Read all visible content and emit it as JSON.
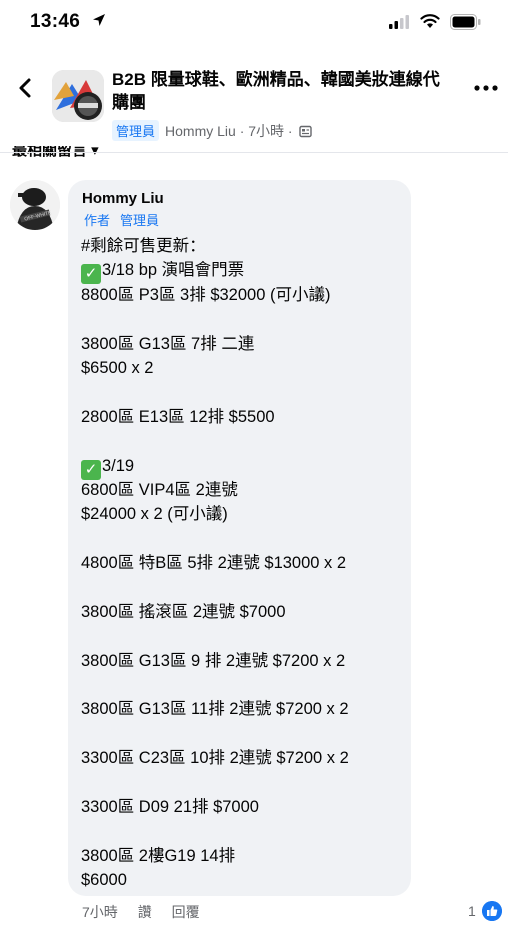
{
  "status_bar": {
    "time": "13:46"
  },
  "header": {
    "group_name": "B2B 限量球鞋、歐洲精品、韓國美妝連線代購團",
    "admin_badge": "管理員",
    "author_meta": "Hommy Liu · 7小時 ·"
  },
  "sort": {
    "label": "最相關留言"
  },
  "comment": {
    "author": "Hommy Liu",
    "badges": [
      "作者",
      "管理員"
    ],
    "lines": [
      {
        "check": false,
        "text": "#剩餘可售更新："
      },
      {
        "check": true,
        "text": "3/18 bp 演唱會門票"
      },
      {
        "check": false,
        "text": "8800區 P3區 3排 $32000 (可小議)"
      },
      {
        "check": false,
        "text": ""
      },
      {
        "check": false,
        "text": "3800區 G13區 7排 二連"
      },
      {
        "check": false,
        "text": "$6500 x 2"
      },
      {
        "check": false,
        "text": ""
      },
      {
        "check": false,
        "text": "2800區 E13區 12排 $5500"
      },
      {
        "check": false,
        "text": ""
      },
      {
        "check": true,
        "text": "3/19"
      },
      {
        "check": false,
        "text": "6800區 VIP4區 2連號"
      },
      {
        "check": false,
        "text": "$24000 x 2 (可小議)"
      },
      {
        "check": false,
        "text": ""
      },
      {
        "check": false,
        "text": "4800區 特B區 5排 2連號 $13000 x 2"
      },
      {
        "check": false,
        "text": ""
      },
      {
        "check": false,
        "text": "3800區 搖滾區 2連號 $7000"
      },
      {
        "check": false,
        "text": ""
      },
      {
        "check": false,
        "text": "3800區 G13區 9 排 2連號  $7200 x 2"
      },
      {
        "check": false,
        "text": ""
      },
      {
        "check": false,
        "text": "3800區 G13區 11排 2連號 $7200 x 2"
      },
      {
        "check": false,
        "text": ""
      },
      {
        "check": false,
        "text": "3300區 C23區 10排 2連號 $7200 x 2"
      },
      {
        "check": false,
        "text": ""
      },
      {
        "check": false,
        "text": "3300區 D09 21排 $7000"
      },
      {
        "check": false,
        "text": ""
      },
      {
        "check": false,
        "text": "3800區 2樓G19 14排"
      },
      {
        "check": false,
        "text": "$6000"
      }
    ],
    "time": "7小時",
    "like_label": "讚",
    "reply_label": "回覆",
    "like_count": "1"
  },
  "icons": {
    "back": "chevron-left-icon",
    "more": "more-dots-icon",
    "location": "location-arrow-icon",
    "signal": "cellular-signal-icon",
    "wifi": "wifi-icon",
    "battery": "battery-icon",
    "like": "like-thumb-icon"
  },
  "colors": {
    "accent": "#1877f2",
    "bubble": "#f0f2f5",
    "meta": "#65676b",
    "check": "#4bb54d"
  }
}
